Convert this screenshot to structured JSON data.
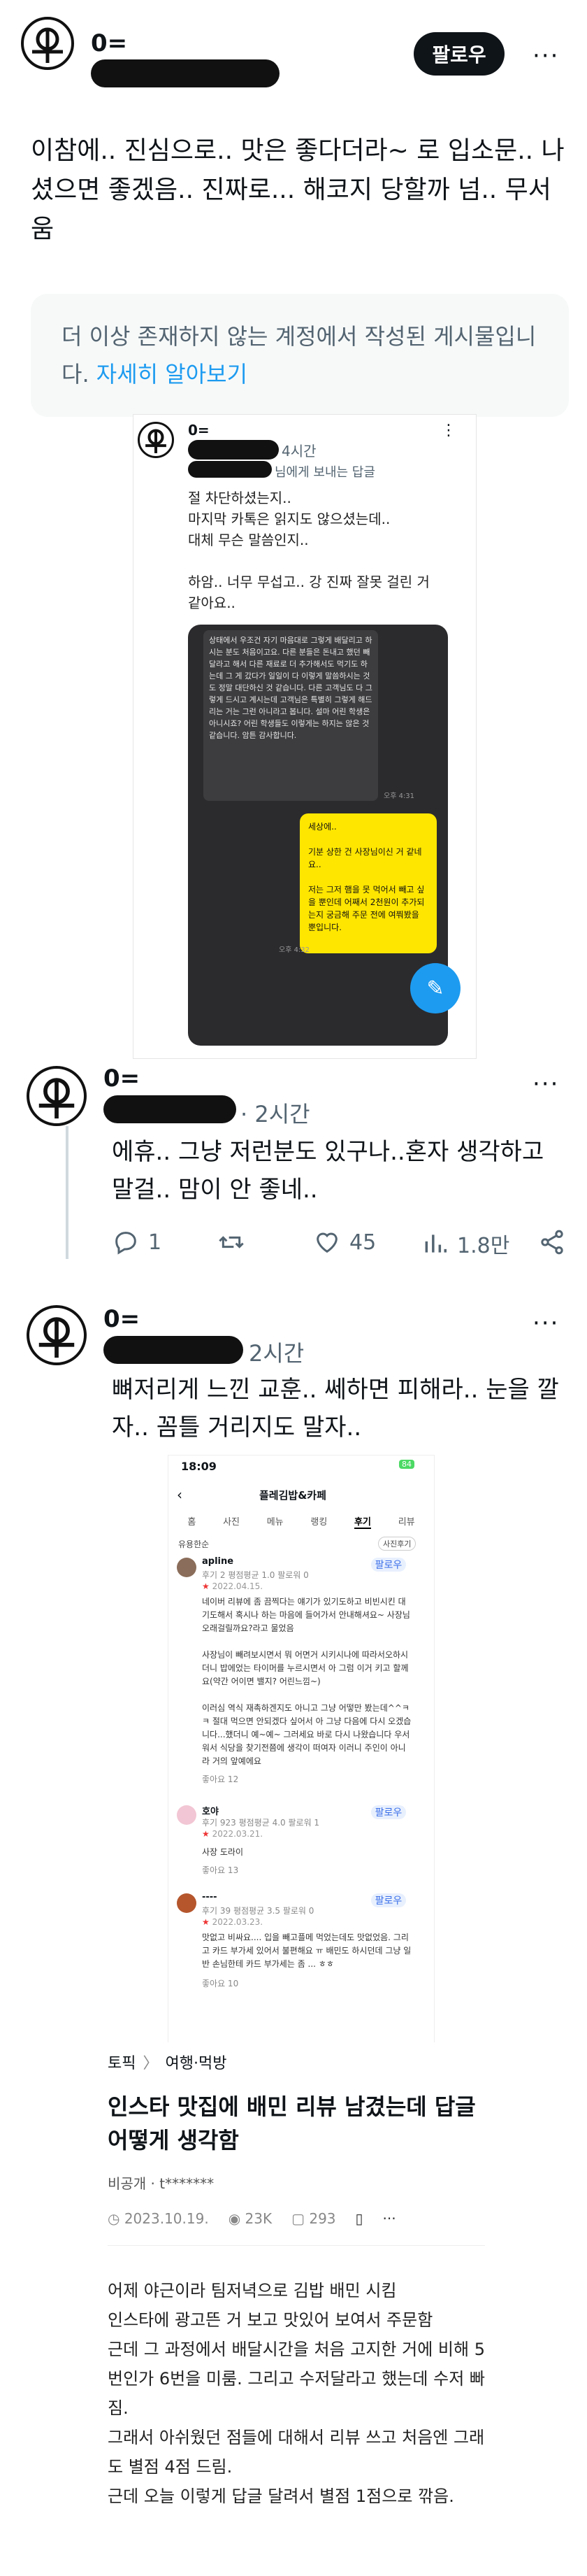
{
  "post1": {
    "username": "0=",
    "follow_label": "팔로우",
    "more": "···",
    "text": "이참에.. 진심으로.. 맛은 좋다더라~ 로 입소문.. 나셨으면 좋겠음.. 진짜로... 해코지 당할까 넘.. 무서움",
    "notice_text": "더 이상 존재하지 않는 계정에서 작성된 게시물입니다.",
    "notice_link": "자세히 알아보기"
  },
  "embed1": {
    "username": "0=",
    "time": "4시간",
    "reply_to": "님에게 보내는 답글",
    "lines": [
      "절 차단하셨는지..",
      "마지막 카톡은 읽지도 않으셨는데..",
      "대체 무슨 말씀인지..",
      "",
      "하암.. 너무 무섭고.. 강 진짜 잘못 걸린 거 같아요.."
    ],
    "phone_text": "상태에서 우조건 자기 마음대로 그렇게 배달리고 하시는 분도 처음이고요. 다른 분들은 돈내고 했던 빼달라고 해서 다른 재료로 더 추가해서도 먹기도 하는데 그 게 갔다가 일일이 다 이렇게 말씀하시는 것도 정말 대단하신 것 같습니다. 다른 고객님도 다 그렇게 드시고 계시는데 고객님은 특별히 그렇게 해드리는 거는 그런 아니라고 봅니다. 설마 어린 학생은 아니시죠? 어린 학생들도 이렇게는 하지는 않은 것 같습니다. 암튼 감사합니다.",
    "phone_time1": "오후 4:31",
    "yellow_text": "세상에..\n\n기분 상한 건 사장님이신 거 같네요..\n\n저는 그저 햄을 못 먹어서 빼고 싶을 뿐인데 어째서 2천원이 추가되는지 궁금해 주문 전에 여쭤봤을 뿐입니다.",
    "phone_time2": "오후 4:32"
  },
  "post2": {
    "username": "0=",
    "time": "· 2시간",
    "text": "에휴.. 그냥 저런분도 있구나..혼자 생각하고 말걸.. 맘이 안 좋네..",
    "replies": "1",
    "retweets": "",
    "likes": "45",
    "views": "1.8만"
  },
  "post3": {
    "username": "0=",
    "time": "2시간",
    "text": "뼈저리게 느낀 교훈.. 쎄하면 피해라.. 눈을 깔자.. 꼼틀 거리지도 말자.."
  },
  "phone_screen": {
    "clock": "18:09",
    "battery": "84",
    "title": "플레김밥&카페",
    "tabs": [
      "홈",
      "사진",
      "메뉴",
      "랭킹",
      "후기",
      "리뷰"
    ],
    "active_tab": "후기",
    "sort": "유용한순",
    "filter": "사진후기",
    "reviews": [
      {
        "name": "apline",
        "stats": "후기 2   평점평균 1.0   팔로워 0",
        "date": "2022.04.15.",
        "follow": "팔로우",
        "body": "네이버 리뷰에 좀 끔찍다는 얘기가 있기도하고 비빈시킨 대기도해서 혹시나 하는 마음에 들어가서 안내해셔요~ 사장님 오래걸릴까요?라고 물었음\n\n사장님이 빼려보시면서 뭐 어면거 시키시나에 따라서오하시더니 밥에었는 타이머를 누르시면서 아 그럼 이거 키고 할께요(약간 어이면 밸지? 어린느낌~)\n\n이러심 역식 재촉하겐지도 아니고 그냥 어떻만 봤는데^^ㅋ ㅋ 절대 먹으면 안되겠다 싶어서 아 그냥 다음에 다시 오겠습니다...했더니 예~예~ 그러세요 바로 다시 나왔습니다 우서워서 식당을 찾기전쯤에 생각이 떠여자 이러니 주인이 아니라 거의 앞예에요",
        "likes": "좋아요 12"
      },
      {
        "name": "호야",
        "stats": "후기 923   평점평균 4.0   팔로워 1",
        "date": "2022.03.21.",
        "follow": "팔로우",
        "body": "사장 도라이",
        "likes": "좋아요 13"
      },
      {
        "name": "----",
        "stats": "후기 39   평점평균 3.5   팔로워 0",
        "date": "2022.03.23.",
        "follow": "팔로우",
        "body": "맛없고 비싸요.... 입을 빼고플메 먹었는데도 맛없었음. 그리고 카드 부가세 있어서 불편해요 ㅠ 배민도 하시던데 그냥 일반 손님한테 카드 부가세는 좀 ... ㅎㅎ",
        "likes": "좋아요 10"
      }
    ]
  },
  "article": {
    "crumb_topic": "토픽",
    "crumb_sep": "〉",
    "crumb_category": "여행·먹방",
    "title": "인스타 맛집에 배민 리뷰 남겼는데 답글 어떻게 생각함",
    "author": "비공개 · t*******",
    "date": "2023.10.19.",
    "views": "23K",
    "comments": "293",
    "more": "···",
    "body": [
      "어제 야근이라 팀저녁으로 김밥 배민 시킴",
      "인스타에 광고뜬 거 보고 맛있어 보여서 주문함",
      "근데 그 과정에서 배달시간을 처음 고지한 거에 비해 5번인가 6번을 미룸. 그리고 수저달라고 했는데 수저 빠짐.",
      "그래서 아쉬웠던 점들에 대해서 리뷰 쓰고 처음엔 그래도 별점 4점 드림.",
      "근데 오늘 이렇게 답글 달려서 별점 1점으로 깎음."
    ]
  },
  "colors": {
    "accent": "#1d9bf0",
    "text": "#0f1419",
    "muted": "#536471",
    "yellow": "#ffe600"
  }
}
